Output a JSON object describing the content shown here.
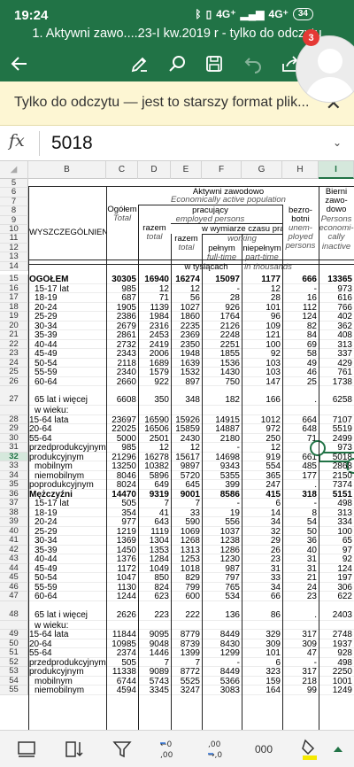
{
  "status": {
    "time": "19:24",
    "network1": "4G⁺",
    "network2": "4G⁺",
    "battery": "34"
  },
  "title": "1. Aktywni zawo....23-I kw.2019 r - tylko do odczytu",
  "notifications": "3",
  "banner": {
    "text": "Tylko do odczytu — jest to starszy format plik..."
  },
  "formula": {
    "fx": "fx",
    "value": "5018"
  },
  "columns": [
    "B",
    "C",
    "D",
    "E",
    "F",
    "G",
    "H",
    "I"
  ],
  "header": {
    "aktywni": "Aktywni zawodowo",
    "aktywni_en": "Economically active population",
    "pracujacy": "pracujący",
    "pracujacy_en": "employed persons",
    "wymiar": "w wymiarze czasu pracy",
    "working": "working",
    "bierni": "Bierni",
    "bierni2": "zawo-",
    "bierni3": "dowo",
    "persons": "Persons",
    "economi": "economi-",
    "cally": "cally",
    "inactive": "inactive",
    "ogolem": "Ogółem",
    "total": "Total",
    "razem": "razem",
    "razem_total": "total",
    "razem2": "razem",
    "razem2_total": "total",
    "pelnym": "pełnym",
    "fulltime": "full-time",
    "niepelnym": "niepełnym",
    "parttime": "part-time",
    "bezro": "bezro-",
    "botni": "botni",
    "unem": "unem-",
    "ployed": "ployed",
    "persons2": "persons",
    "wyszczegolnienie": "WYSZCZEGÓLNIENIE",
    "tysiacach": "w tysiącach",
    "thousands": "in thousands"
  },
  "header_rows": [
    "5",
    "6",
    "7",
    "8",
    "9",
    "10",
    "11",
    "12",
    "13",
    "14"
  ],
  "rows": [
    {
      "n": "15",
      "label": "OGÓŁEM",
      "bold": true,
      "v": [
        "30305",
        "16940",
        "16274",
        "15097",
        "1177",
        "666",
        "13365"
      ]
    },
    {
      "n": "16",
      "label": "15-17  lat",
      "v": [
        "985",
        "12",
        "12",
        "-",
        "12",
        "-",
        "973"
      ]
    },
    {
      "n": "17",
      "label": "18-19",
      "v": [
        "687",
        "71",
        "56",
        "28",
        "28",
        "16",
        "616"
      ]
    },
    {
      "n": "18",
      "label": "20-24",
      "v": [
        "1905",
        "1139",
        "1027",
        "926",
        "101",
        "112",
        "766"
      ]
    },
    {
      "n": "19",
      "label": "25-29",
      "v": [
        "2386",
        "1984",
        "1860",
        "1764",
        "96",
        "124",
        "402"
      ]
    },
    {
      "n": "20",
      "label": "30-34",
      "v": [
        "2679",
        "2316",
        "2235",
        "2126",
        "109",
        "82",
        "362"
      ]
    },
    {
      "n": "21",
      "label": "35-39",
      "v": [
        "2861",
        "2453",
        "2369",
        "2248",
        "121",
        "84",
        "408"
      ]
    },
    {
      "n": "22",
      "label": "40-44",
      "v": [
        "2732",
        "2419",
        "2350",
        "2251",
        "100",
        "69",
        "313"
      ]
    },
    {
      "n": "23",
      "label": "45-49",
      "v": [
        "2343",
        "2006",
        "1948",
        "1855",
        "92",
        "58",
        "337"
      ]
    },
    {
      "n": "24",
      "label": "50-54",
      "v": [
        "2118",
        "1689",
        "1639",
        "1536",
        "103",
        "49",
        "429"
      ]
    },
    {
      "n": "25",
      "label": "55-59",
      "v": [
        "2340",
        "1579",
        "1532",
        "1430",
        "103",
        "46",
        "761"
      ]
    },
    {
      "n": "26",
      "label": "60-64",
      "v": [
        "2660",
        "922",
        "897",
        "750",
        "147",
        "25",
        "1738"
      ]
    },
    {
      "n": "27",
      "label": "65  lat i więcej",
      "tall": true,
      "v": [
        "6608",
        "350",
        "348",
        "182",
        "166",
        ".",
        "6258"
      ]
    },
    {
      "n": "",
      "label": "w wieku:",
      "v": [
        "",
        "",
        "",
        "",
        "",
        "",
        ""
      ]
    },
    {
      "n": "28",
      "label": "15-64  lata",
      "v": [
        "23697",
        "16590",
        "15926",
        "14915",
        "1012",
        "664",
        "7107"
      ]
    },
    {
      "n": "29",
      "label": "20-64",
      "v": [
        "22025",
        "16506",
        "15859",
        "14887",
        "972",
        "648",
        "5519"
      ]
    },
    {
      "n": "30",
      "label": "55-64",
      "v": [
        "5000",
        "2501",
        "2430",
        "2180",
        "250",
        "71",
        "2499"
      ]
    },
    {
      "n": "31",
      "label": "przedprodukcyjnym",
      "v": [
        "985",
        "12",
        "12",
        "-",
        "12",
        "-",
        "973"
      ]
    },
    {
      "n": "32",
      "label": "produkcyjnym",
      "sel": true,
      "v": [
        "21296",
        "16278",
        "15617",
        "14698",
        "919",
        "661",
        "5018"
      ]
    },
    {
      "n": "33",
      "label": "mobilnym",
      "v": [
        "13250",
        "10382",
        "9897",
        "9343",
        "554",
        "485",
        "2868"
      ]
    },
    {
      "n": "34",
      "label": "niemobilnym",
      "v": [
        "8046",
        "5896",
        "5720",
        "5355",
        "365",
        "177",
        "2150"
      ]
    },
    {
      "n": "35",
      "label": "poprodukcyjnym",
      "v": [
        "8024",
        "649",
        "645",
        "399",
        "247",
        ".",
        "7374"
      ]
    },
    {
      "n": "36",
      "label": "Mężczyźni",
      "bold": true,
      "v": [
        "14470",
        "9319",
        "9001",
        "8586",
        "415",
        "318",
        "5151"
      ]
    },
    {
      "n": "37",
      "label": "15-17  lat",
      "v": [
        "505",
        "7",
        "7",
        "-",
        "6",
        "-",
        "498"
      ]
    },
    {
      "n": "38",
      "label": "18-19",
      "v": [
        "354",
        "41",
        "33",
        "19",
        "14",
        "8",
        "313"
      ]
    },
    {
      "n": "39",
      "label": "20-24",
      "v": [
        "977",
        "643",
        "590",
        "556",
        "34",
        "54",
        "334"
      ]
    },
    {
      "n": "40",
      "label": "25-29",
      "v": [
        "1219",
        "1119",
        "1069",
        "1037",
        "32",
        "50",
        "100"
      ]
    },
    {
      "n": "41",
      "label": "30-34",
      "v": [
        "1369",
        "1304",
        "1268",
        "1238",
        "29",
        "36",
        "65"
      ]
    },
    {
      "n": "42",
      "label": "35-39",
      "v": [
        "1450",
        "1353",
        "1313",
        "1286",
        "26",
        "40",
        "97"
      ]
    },
    {
      "n": "43",
      "label": "40-44",
      "v": [
        "1376",
        "1284",
        "1253",
        "1230",
        "23",
        "31",
        "92"
      ]
    },
    {
      "n": "44",
      "label": "45-49",
      "v": [
        "1172",
        "1049",
        "1018",
        "987",
        "31",
        "31",
        "124"
      ]
    },
    {
      "n": "45",
      "label": "50-54",
      "v": [
        "1047",
        "850",
        "829",
        "797",
        "33",
        "21",
        "197"
      ]
    },
    {
      "n": "46",
      "label": "55-59",
      "v": [
        "1130",
        "824",
        "799",
        "765",
        "34",
        "24",
        "306"
      ]
    },
    {
      "n": "47",
      "label": "60-64",
      "v": [
        "1244",
        "623",
        "600",
        "534",
        "66",
        "23",
        "622"
      ]
    },
    {
      "n": "48",
      "label": "65  lat i więcej",
      "tall": true,
      "v": [
        "2626",
        "223",
        "222",
        "136",
        "86",
        ".",
        "2403"
      ]
    },
    {
      "n": "",
      "label": "w wieku:",
      "v": [
        "",
        "",
        "",
        "",
        "",
        "",
        ""
      ]
    },
    {
      "n": "49",
      "label": "15-64  lata",
      "v": [
        "11844",
        "9095",
        "8779",
        "8449",
        "329",
        "317",
        "2748"
      ]
    },
    {
      "n": "50",
      "label": "20-64",
      "v": [
        "10985",
        "9048",
        "8739",
        "8430",
        "309",
        "309",
        "1937"
      ]
    },
    {
      "n": "51",
      "label": "55-64",
      "v": [
        "2374",
        "1446",
        "1399",
        "1299",
        "101",
        "47",
        "928"
      ]
    },
    {
      "n": "52",
      "label": "przedprodukcyjnym",
      "v": [
        "505",
        "7",
        "7",
        "-",
        "6",
        "-",
        "498"
      ]
    },
    {
      "n": "53",
      "label": "produkcyjnym",
      "v": [
        "11338",
        "9089",
        "8772",
        "8449",
        "323",
        "317",
        "2250"
      ]
    },
    {
      "n": "54",
      "label": "mobilnym",
      "v": [
        "6744",
        "5743",
        "5525",
        "5366",
        "159",
        "218",
        "1001"
      ]
    },
    {
      "n": "55",
      "label": "niemobilnym",
      "v": [
        "4594",
        "3345",
        "3247",
        "3083",
        "164",
        "99",
        "1249"
      ]
    }
  ],
  "bottom": {
    "format": "000"
  }
}
